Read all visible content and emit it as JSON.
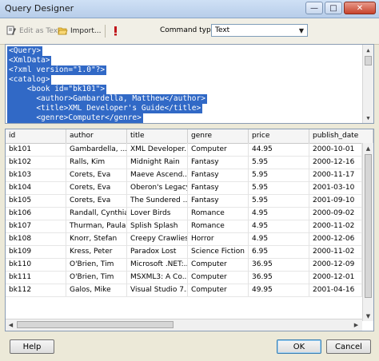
{
  "window": {
    "title": "Query Designer"
  },
  "toolbar": {
    "edit_as_text": "Edit as Text",
    "import": "Import...",
    "command_type_label": "Command type:",
    "command_type_value": "Text"
  },
  "editor": {
    "lines": [
      "<Query>",
      "<XmlData>",
      "<?xml version=\"1.0\"?>",
      "<catalog>",
      "    <book id=\"bk101\">",
      "      <author>Gambardella, Matthew</author>",
      "      <title>XML Developer's Guide</title>",
      "      <genre>Computer</genre>"
    ]
  },
  "grid": {
    "columns": [
      "id",
      "author",
      "title",
      "genre",
      "price",
      "publish_date"
    ],
    "rows": [
      [
        "bk101",
        "Gambardella, ...",
        "XML Developer...",
        "Computer",
        "44.95",
        "2000-10-01"
      ],
      [
        "bk102",
        "Ralls, Kim",
        "Midnight Rain",
        "Fantasy",
        "5.95",
        "2000-12-16"
      ],
      [
        "bk103",
        "Corets, Eva",
        "Maeve Ascend...",
        "Fantasy",
        "5.95",
        "2000-11-17"
      ],
      [
        "bk104",
        "Corets, Eva",
        "Oberon's Legacy",
        "Fantasy",
        "5.95",
        "2001-03-10"
      ],
      [
        "bk105",
        "Corets, Eva",
        "The Sundered ...",
        "Fantasy",
        "5.95",
        "2001-09-10"
      ],
      [
        "bk106",
        "Randall, Cynthia",
        "Lover Birds",
        "Romance",
        "4.95",
        "2000-09-02"
      ],
      [
        "bk107",
        "Thurman, Paula",
        "Splish Splash",
        "Romance",
        "4.95",
        "2000-11-02"
      ],
      [
        "bk108",
        "Knorr, Stefan",
        "Creepy Crawlies",
        "Horror",
        "4.95",
        "2000-12-06"
      ],
      [
        "bk109",
        "Kress, Peter",
        "Paradox Lost",
        "Science Fiction",
        "6.95",
        "2000-11-02"
      ],
      [
        "bk110",
        "O'Brien, Tim",
        "Microsoft .NET:...",
        "Computer",
        "36.95",
        "2000-12-09"
      ],
      [
        "bk111",
        "O'Brien, Tim",
        "MSXML3: A Co...",
        "Computer",
        "36.95",
        "2000-12-01"
      ],
      [
        "bk112",
        "Galos, Mike",
        "Visual Studio 7...",
        "Computer",
        "49.95",
        "2001-04-16"
      ]
    ]
  },
  "buttons": {
    "help": "Help",
    "ok": "OK",
    "cancel": "Cancel"
  },
  "colors": {
    "selection": "#3169c6",
    "title_bar": "#b7cde9",
    "close_button": "#c7432c"
  }
}
